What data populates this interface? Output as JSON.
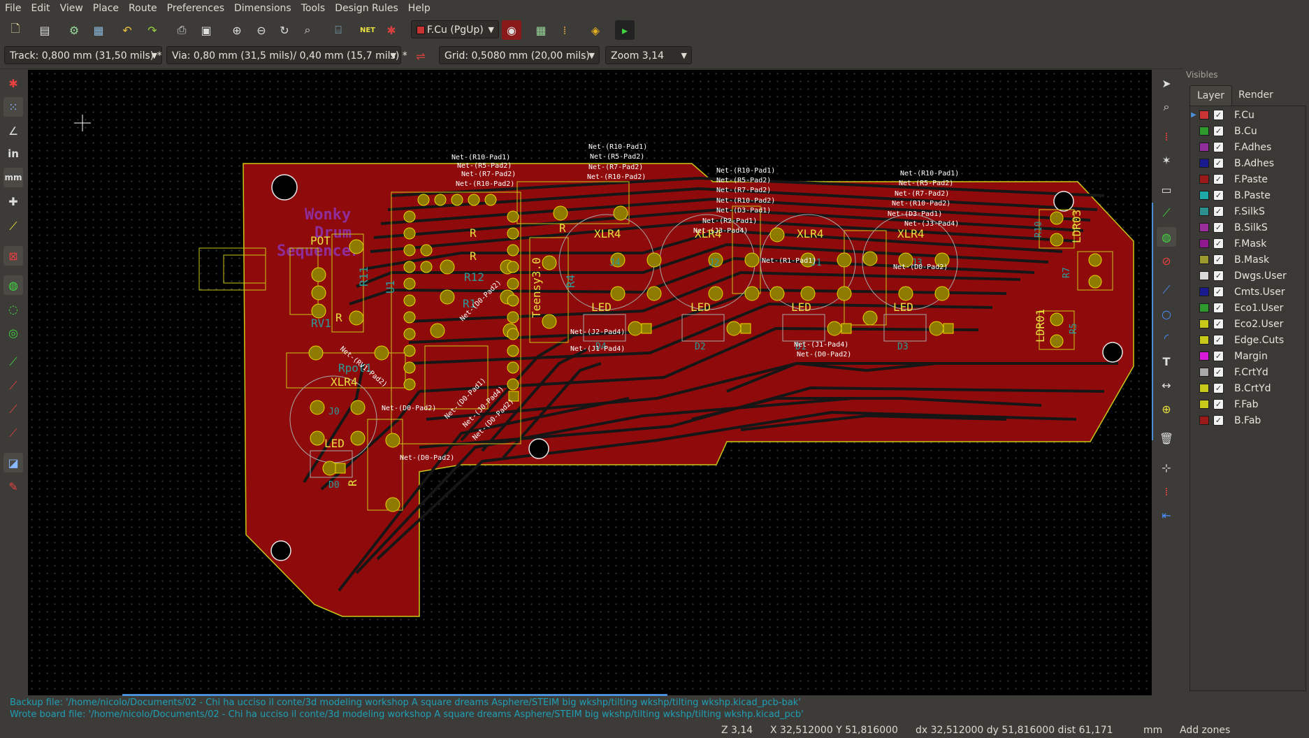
{
  "menu": [
    "File",
    "Edit",
    "View",
    "Place",
    "Route",
    "Preferences",
    "Dimensions",
    "Tools",
    "Design Rules",
    "Help"
  ],
  "toolbar": {
    "layer_select": "F.Cu (PgUp)",
    "track_select": "Track: 0,800 mm (31,50 mils) *",
    "via_select": "Via: 0,80 mm (31,5 mils)/ 0,40 mm (15,7 mils) *",
    "grid_select": "Grid: 0,5080 mm (20,00 mils)",
    "zoom_select": "Zoom 3,14"
  },
  "left_toolbar": {
    "units_in": "in",
    "units_mm": "mm"
  },
  "panel": {
    "title": "Visibles",
    "tabs": [
      "Layer",
      "Render"
    ],
    "layers": [
      {
        "name": "F.Cu",
        "color": "#c83434",
        "active": true
      },
      {
        "name": "B.Cu",
        "color": "#2e9a2e"
      },
      {
        "name": "F.Adhes",
        "color": "#8f2e9a"
      },
      {
        "name": "B.Adhes",
        "color": "#1a1a8f"
      },
      {
        "name": "F.Paste",
        "color": "#9a1a1a"
      },
      {
        "name": "B.Paste",
        "color": "#1fa8a8"
      },
      {
        "name": "F.SilkS",
        "color": "#2e8f8f"
      },
      {
        "name": "B.SilkS",
        "color": "#9a2e9a"
      },
      {
        "name": "F.Mask",
        "color": "#8f1a8f"
      },
      {
        "name": "B.Mask",
        "color": "#9a9a2e"
      },
      {
        "name": "Dwgs.User",
        "color": "#d8d8d8"
      },
      {
        "name": "Cmts.User",
        "color": "#1a1a8f"
      },
      {
        "name": "Eco1.User",
        "color": "#2e9a2e"
      },
      {
        "name": "Eco2.User",
        "color": "#c8c81a"
      },
      {
        "name": "Edge.Cuts",
        "color": "#c8c81a"
      },
      {
        "name": "Margin",
        "color": "#d81ad8"
      },
      {
        "name": "F.CrtYd",
        "color": "#a8a8a8"
      },
      {
        "name": "B.CrtYd",
        "color": "#c8c81a"
      },
      {
        "name": "F.Fab",
        "color": "#c8c81a"
      },
      {
        "name": "B.Fab",
        "color": "#9a1a1a"
      }
    ]
  },
  "pcb": {
    "title_text": [
      "Wonky",
      "Drum",
      "Sequencer"
    ],
    "refs": [
      "POT",
      "RV1",
      "Rpot1",
      "XLR4",
      "J0",
      "LED",
      "D0",
      "U1",
      "Teensy3.0",
      "R",
      "R12",
      "R1",
      "R11",
      "XLR4",
      "J4",
      "XLR4",
      "J2",
      "XLR4",
      "J1",
      "XLR4",
      "J3",
      "LED",
      "D4",
      "LED",
      "D2",
      "LED",
      "D1",
      "LED",
      "D3",
      "LDR03",
      "LDR01",
      "R10",
      "R7",
      "R5",
      "R4",
      "R",
      "R",
      "R",
      "R"
    ],
    "nets": [
      "Net-(R10-Pad1)",
      "Net-(R5-Pad2)",
      "Net-(R7-Pad2)",
      "Net-(R10-Pad2)",
      "Net-(R10-Pad1)",
      "Net-(R5-Pad2)",
      "Net-(R7-Pad2)",
      "Net-(R10-Pad2)",
      "Net-(R10-Pad1)",
      "Net-(R5-Pad2)",
      "Net-(R7-Pad2)",
      "Net-(R10-Pad2)",
      "Net-(D3-Pad1)",
      "Net-(R2-Pad1)",
      "Net-(J3-Pad4)",
      "Net-(R10-Pad1)",
      "Net-(R5-Pad2)",
      "Net-(R7-Pad2)",
      "Net-(R10-Pad2)",
      "Net-(D3-Pad1)",
      "Net-(J3-Pad4)",
      "Net-(R1-Pad1)",
      "Net-(D0-Pad2)",
      "Net-(J2-Pad4)",
      "Net-(J1-Pad4)",
      "Net-(J1-Pad4)",
      "Net-(D0-Pad2)",
      "Net-(D0-Pad2)",
      "Net-(D0-Pad2)",
      "Net-(RV1-Pad2)",
      "Net-(D0-Pad1)",
      "Net-(J0-Pad4)",
      "Net-(D0-Pad2)",
      "Net-(D0-Pad2)"
    ]
  },
  "messages": [
    "Backup file: '/home/nicolo/Documents/02 - Chi ha ucciso il conte/3d modeling workshop A square dreams Asphere/STEIM big wkshp/tilting wkshp/tilting wkshp.kicad_pcb-bak'",
    "Wrote board file: '/home/nicolo/Documents/02 - Chi ha ucciso il conte/3d modeling workshop A square dreams Asphere/STEIM big wkshp/tilting wkshp/tilting wkshp.kicad_pcb'"
  ],
  "status": {
    "zoom": "Z 3,14",
    "xy": "X 32,512000  Y 51,816000",
    "delta": "dx 32,512000  dy 51,816000  dist 61,171",
    "units": "mm",
    "mode": "Add zones"
  }
}
